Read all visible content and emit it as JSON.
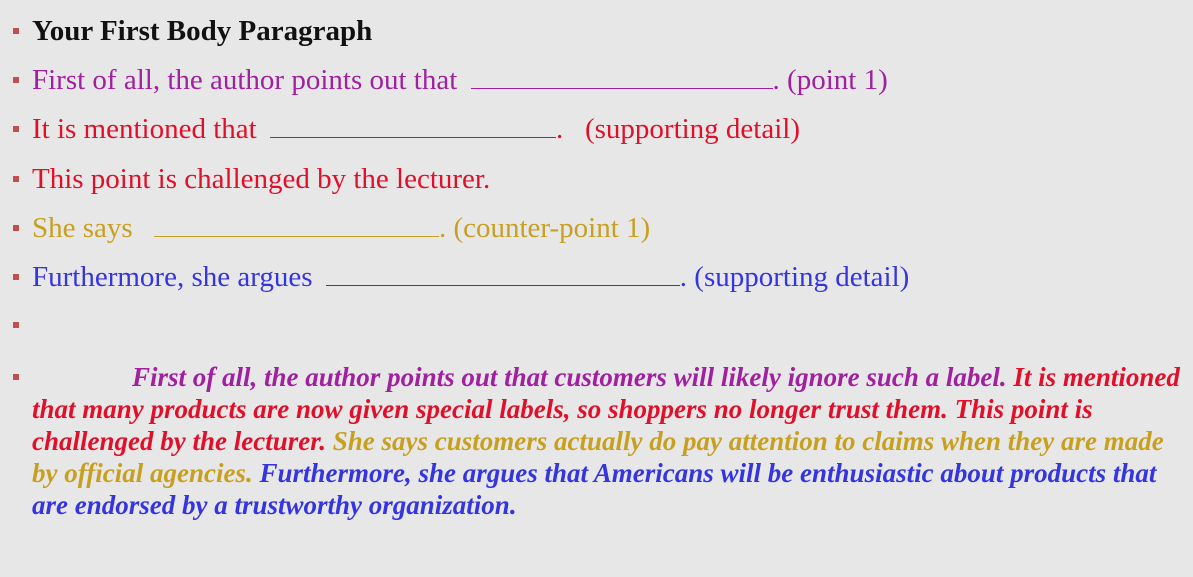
{
  "colors": {
    "purple": "#a020a0",
    "red": "#e0102a",
    "gold": "#c8a020",
    "blue": "#3535e0",
    "bullet": "#c0504d",
    "background": "#e7e7e7"
  },
  "title": "Your First Body Paragraph",
  "lines": [
    {
      "before": "First of all, the author points out that",
      "after": ". (point 1)"
    },
    {
      "before": "It is mentioned that",
      "after": ".   (supporting detail)"
    },
    {
      "before": "This point is challenged by the lecturer.",
      "after": ""
    },
    {
      "before": "She says",
      "after": ". (counter-point 1)"
    },
    {
      "before": "Furthermore, she argues",
      "after": ". (supporting detail)"
    }
  ],
  "paragraph": {
    "s1": "First of all, the author points out that customers will likely ignore such a label.",
    "s2": "It is mentioned that many products are now given special labels, so shoppers no longer trust them.",
    "s3": "This point is challenged by the lecturer.",
    "s4": "She says customers actually do pay attention to claims when they are made by official agencies.",
    "s5": "Furthermore, she  argues that Americans will be enthusiastic about products that are endorsed by a trustworthy organization."
  }
}
